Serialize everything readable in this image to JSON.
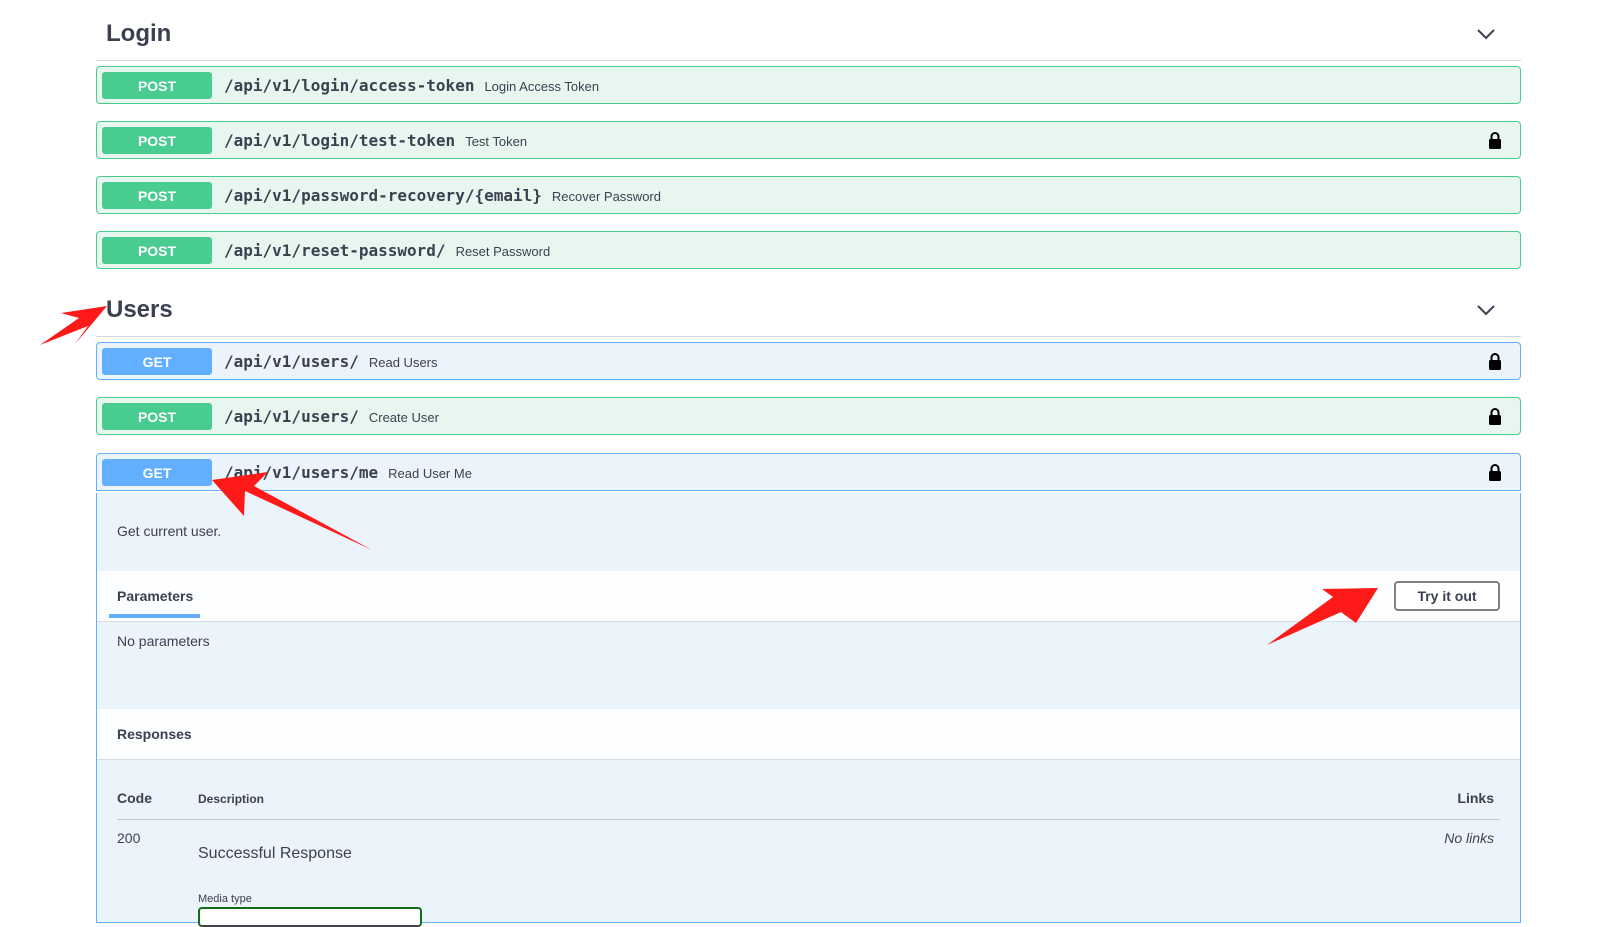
{
  "sections": {
    "login": {
      "title": "Login",
      "operations": [
        {
          "method": "POST",
          "path": "/api/v1/login/access-token",
          "summary": "Login Access Token"
        },
        {
          "method": "POST",
          "path": "/api/v1/login/test-token",
          "summary": "Test Token"
        },
        {
          "method": "POST",
          "path": "/api/v1/password-recovery/{email}",
          "summary": "Recover Password"
        },
        {
          "method": "POST",
          "path": "/api/v1/reset-password/",
          "summary": "Reset Password"
        }
      ]
    },
    "users": {
      "title": "Users",
      "operations": [
        {
          "method": "GET",
          "path": "/api/v1/users/",
          "summary": "Read Users"
        },
        {
          "method": "POST",
          "path": "/api/v1/users/",
          "summary": "Create User"
        },
        {
          "method": "GET",
          "path": "/api/v1/users/me",
          "summary": "Read User Me"
        }
      ]
    }
  },
  "expanded": {
    "description": "Get current user.",
    "parameters_tab": "Parameters",
    "try_button": "Try it out",
    "no_params": "No parameters",
    "responses_title": "Responses",
    "columns": {
      "code": "Code",
      "description": "Description",
      "links": "Links"
    },
    "rows": [
      {
        "code": "200",
        "description": "Successful Response",
        "links": "No links"
      }
    ],
    "media_type_label": "Media type"
  },
  "colors": {
    "post": "#49cc90",
    "get": "#61affe",
    "annotation_arrow": "#ff0000"
  },
  "icons": [
    "chevron-down-icon",
    "lock-icon"
  ]
}
